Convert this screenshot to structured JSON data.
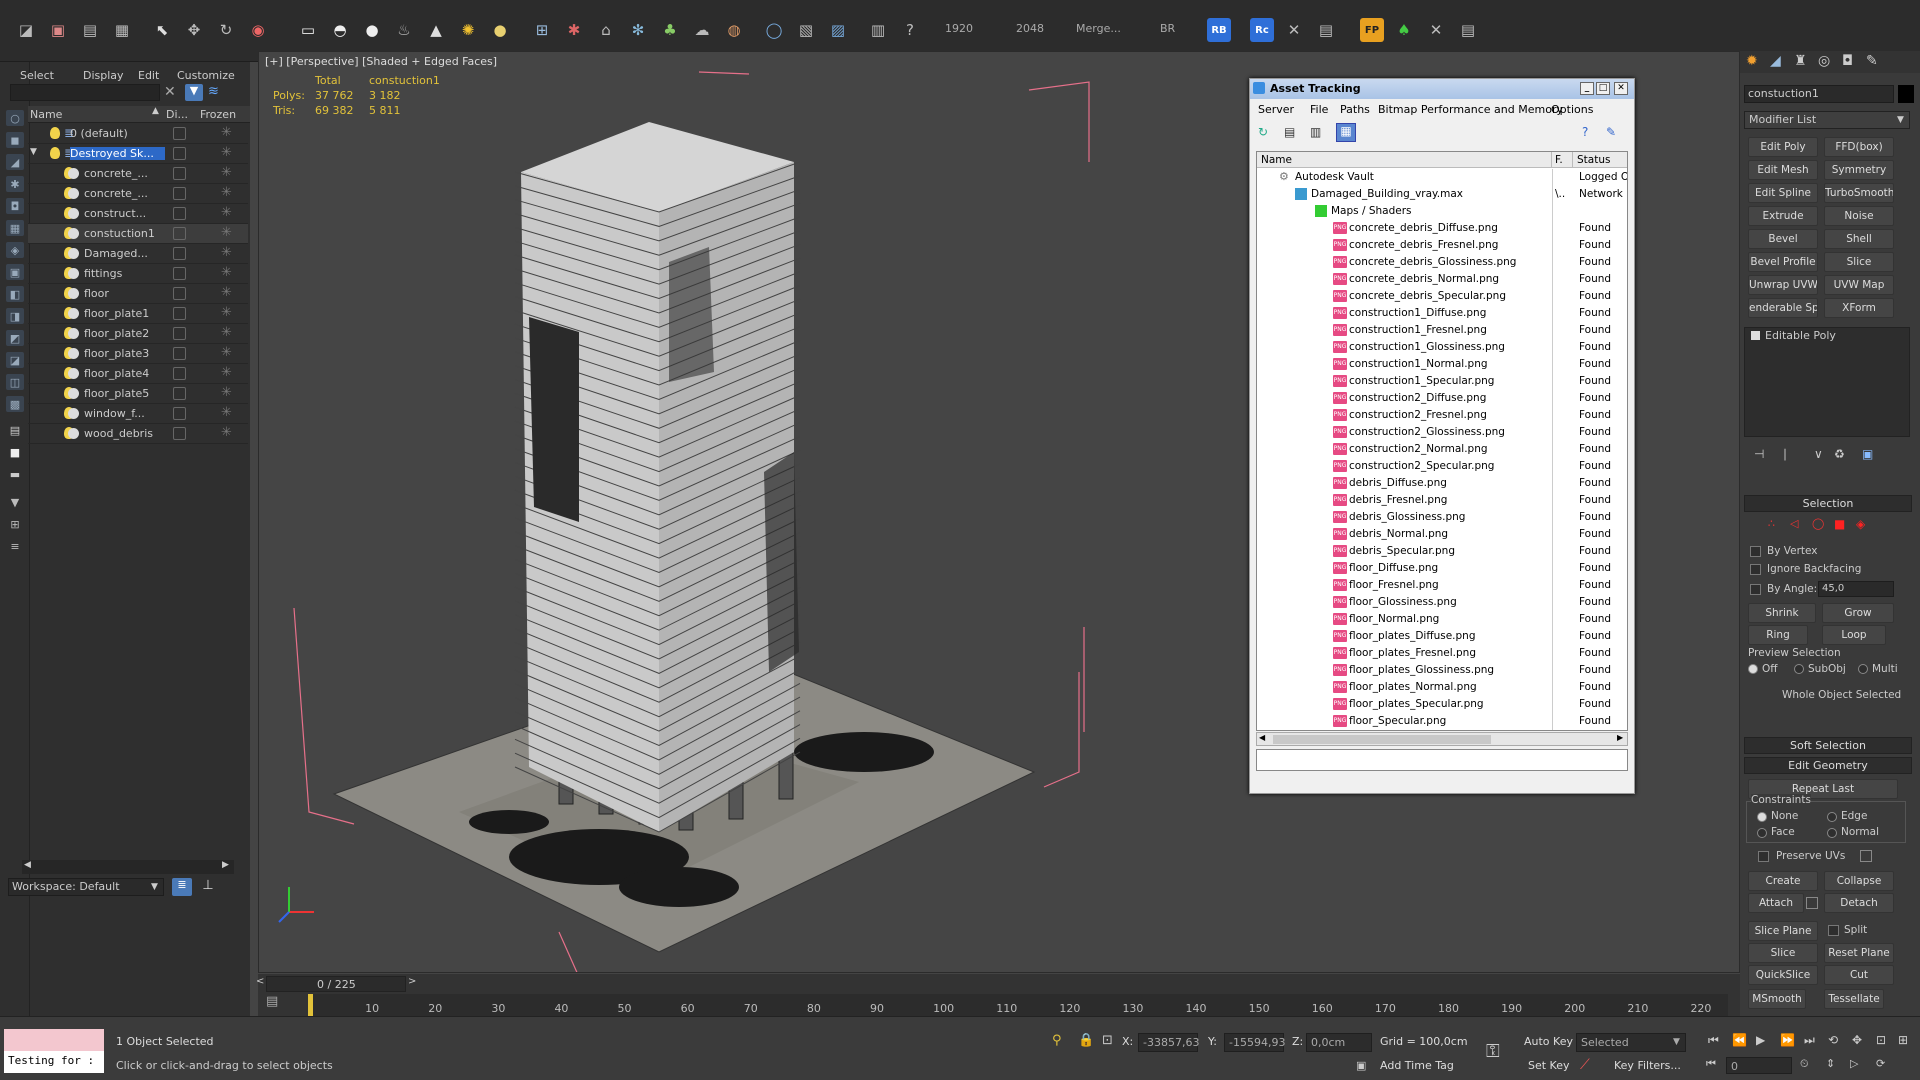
{
  "toolbar": {
    "render_width": "1920",
    "render_height": "2048",
    "merge": "Merge...",
    "br": "BR",
    "rb": "RB",
    "rc": "Rc",
    "fp": "FP"
  },
  "explorer": {
    "menu": [
      "Select",
      "Display",
      "Edit",
      "Customize"
    ],
    "col_name": "Name",
    "col_display": "Di...",
    "col_frozen": "Frozen",
    "layers": [
      {
        "name": "0 (default)",
        "level": 0
      },
      {
        "name": "Destroyed Sk...",
        "level": 0
      },
      {
        "name": "concrete_...",
        "level": 1
      },
      {
        "name": "concrete_...",
        "level": 1
      },
      {
        "name": "construct...",
        "level": 1
      },
      {
        "name": "constuction1",
        "level": 1
      },
      {
        "name": "Damaged...",
        "level": 1
      },
      {
        "name": "fittings",
        "level": 1
      },
      {
        "name": "floor",
        "level": 1
      },
      {
        "name": "floor_plate1",
        "level": 1
      },
      {
        "name": "floor_plate2",
        "level": 1
      },
      {
        "name": "floor_plate3",
        "level": 1
      },
      {
        "name": "floor_plate4",
        "level": 1
      },
      {
        "name": "floor_plate5",
        "level": 1
      },
      {
        "name": "window_f...",
        "level": 1
      },
      {
        "name": "wood_debris",
        "level": 1
      }
    ],
    "workspace": "Workspace: Default"
  },
  "viewport": {
    "label": "[+] [Perspective] [Shaded + Edged Faces]",
    "stats": {
      "col_total": "Total",
      "col_object": "constuction1",
      "polys_label": "Polys:",
      "polys_total": "37 762",
      "polys_obj": "3 182",
      "tris_label": "Tris:",
      "tris_total": "69 382",
      "tris_obj": "5 811"
    }
  },
  "asset": {
    "title": "Asset Tracking",
    "menu": [
      "Server",
      "File",
      "Paths",
      "Bitmap Performance and Memory",
      "Options"
    ],
    "col_name": "Name",
    "col_f": "F.",
    "col_status": "Status",
    "vault": {
      "name": "Autodesk Vault",
      "status": "Logged Ou"
    },
    "scene_file": {
      "name": "Damaged_Building_vray.max",
      "f": "\\..",
      "status": "Network P"
    },
    "group": "Maps / Shaders",
    "files": [
      "concrete_debris_Diffuse.png",
      "concrete_debris_Fresnel.png",
      "concrete_debris_Glossiness.png",
      "concrete_debris_Normal.png",
      "concrete_debris_Specular.png",
      "construction1_Diffuse.png",
      "construction1_Fresnel.png",
      "construction1_Glossiness.png",
      "construction1_Normal.png",
      "construction1_Specular.png",
      "construction2_Diffuse.png",
      "construction2_Fresnel.png",
      "construction2_Glossiness.png",
      "construction2_Normal.png",
      "construction2_Specular.png",
      "debris_Diffuse.png",
      "debris_Fresnel.png",
      "debris_Glossiness.png",
      "debris_Normal.png",
      "debris_Specular.png",
      "floor_Diffuse.png",
      "floor_Fresnel.png",
      "floor_Glossiness.png",
      "floor_Normal.png",
      "floor_plates_Diffuse.png",
      "floor_plates_Fresnel.png",
      "floor_plates_Glossiness.png",
      "floor_plates_Normal.png",
      "floor_plates_Specular.png",
      "floor_Specular.png"
    ],
    "found": "Found"
  },
  "cmd": {
    "object_name": "constuction1",
    "modifier_list": "Modifier List",
    "buttons": [
      [
        "Edit Poly",
        "FFD(box)"
      ],
      [
        "Edit Mesh",
        "Symmetry"
      ],
      [
        "Edit Spline",
        "TurboSmooth"
      ],
      [
        "Extrude",
        "Noise"
      ],
      [
        "Bevel",
        "Shell"
      ],
      [
        "Bevel Profile",
        "Slice"
      ],
      [
        "Unwrap UVW",
        "UVW Map"
      ],
      [
        "enderable Splir",
        "XForm"
      ]
    ],
    "stack_item": "Editable Poly",
    "selection_title": "Selection",
    "by_vertex": "By Vertex",
    "ignore_backfacing": "Ignore Backfacing",
    "by_angle": "By Angle:",
    "angle_value": "45,0",
    "shrink": "Shrink",
    "grow": "Grow",
    "ring": "Ring",
    "loop": "Loop",
    "preview_selection": "Preview Selection",
    "preview_off": "Off",
    "preview_subobj": "SubObj",
    "preview_multi": "Multi",
    "whole_object": "Whole Object Selected",
    "soft_selection": "Soft Selection",
    "edit_geometry": "Edit Geometry",
    "repeat_last": "Repeat Last",
    "constraints": "Constraints",
    "c_none": "None",
    "c_edge": "Edge",
    "c_face": "Face",
    "c_normal": "Normal",
    "preserve_uvs": "Preserve UVs",
    "create": "Create",
    "collapse": "Collapse",
    "attach": "Attach",
    "detach": "Detach",
    "slice_plane": "Slice Plane",
    "split": "Split",
    "slice": "Slice",
    "reset_plane": "Reset Plane",
    "quickslice": "QuickSlice",
    "cut": "Cut",
    "msmooth": "MSmooth",
    "tessellate": "Tessellate"
  },
  "timeline": {
    "frame": "0 / 225",
    "ticks": [
      "10",
      "20",
      "30",
      "40",
      "50",
      "60",
      "70",
      "80",
      "90",
      "100",
      "110",
      "120",
      "130",
      "140",
      "150",
      "160",
      "170",
      "180",
      "190",
      "200",
      "210",
      "220"
    ],
    "progress": 0
  },
  "status": {
    "maxscript": "Testing for :",
    "selected": "1 Object Selected",
    "prompt": "Click or click-and-drag to select objects",
    "x_label": "X:",
    "x_val": "-33857,63",
    "y_label": "Y:",
    "y_val": "-15594,93",
    "z_label": "Z:",
    "z_val": "0,0cm",
    "grid": "Grid = 100,0cm",
    "add_time_tag": "Add Time Tag",
    "auto_key": "Auto Key",
    "set_key": "Set Key",
    "selected_dd": "Selected",
    "key_filters": "Key Filters...",
    "frame_val": "0"
  }
}
